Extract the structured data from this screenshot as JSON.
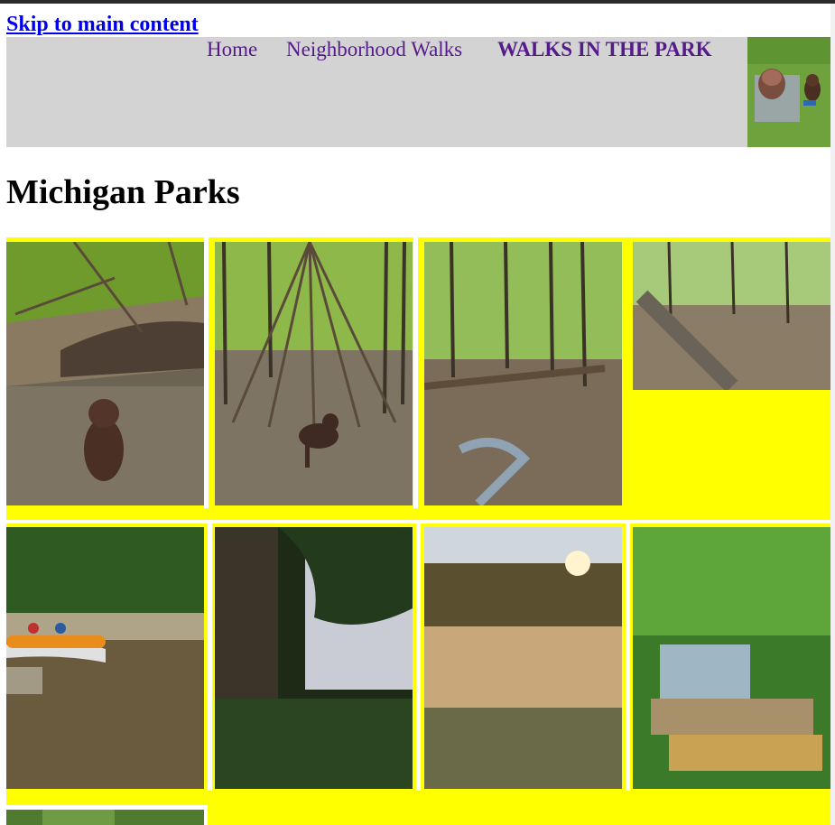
{
  "skip_link": "Skip to main content",
  "nav": {
    "home": "Home",
    "walks": "Neighborhood Walks",
    "park": "WALKS IN THE PARK"
  },
  "page_title": "Michigan Parks",
  "colors": {
    "header_bg": "#d3d3d3",
    "gallery_bg": "#ffff00",
    "link": "#551a8b",
    "skip_link": "#0000ee"
  },
  "photos": [
    "dog-by-creek",
    "dog-by-teepee",
    "forest-creek",
    "fallen-log",
    "kayaks-on-river",
    "tree-by-lake",
    "misty-river-sunrise",
    "waterfall",
    "forest-partial"
  ]
}
